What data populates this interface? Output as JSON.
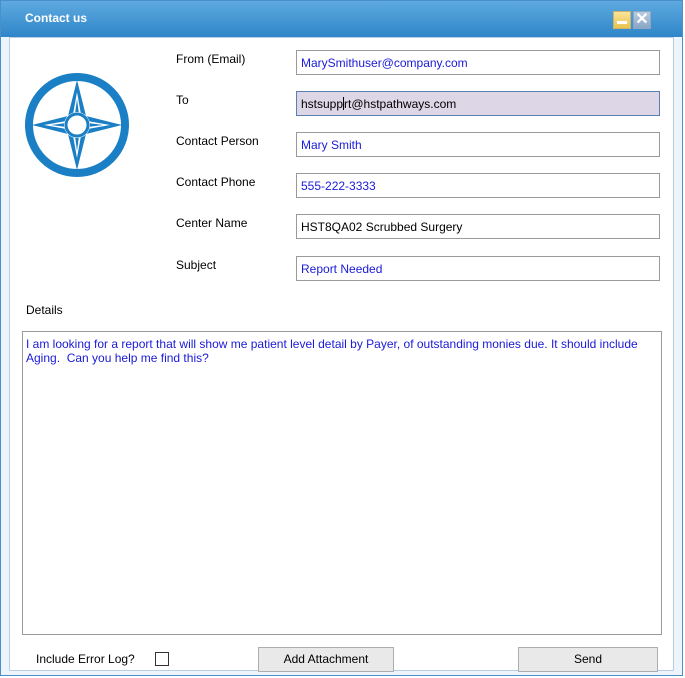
{
  "window": {
    "title": "Contact us",
    "minimize_icon": "minimize-icon",
    "close_icon": "close-icon",
    "close_glyph": "✕"
  },
  "logo": {
    "icon": "compass-logo-icon",
    "color": "#1a7fc4"
  },
  "form": {
    "from_label": "From  (Email)",
    "from_value": "MarySmithuser@company.com",
    "to_label": "To",
    "to_value_before_caret": "hstsupp",
    "to_value_after_caret": "rt@hstpathways.com",
    "contact_person_label": "Contact Person",
    "contact_person_value": "Mary Smith",
    "contact_phone_label": "Contact Phone",
    "contact_phone_value": "555-222-3333",
    "center_name_label": "Center Name",
    "center_name_value": "HST8QA02 Scrubbed Surgery",
    "subject_label": "Subject",
    "subject_value": "Report Needed",
    "details_label": "Details",
    "details_value": "I am looking for a report that will show me patient level detail by Payer, of outstanding monies due. It should include Aging.  Can you help me find this?"
  },
  "footer": {
    "include_error_log_label": "Include Error Log?",
    "include_error_log_checked": false,
    "add_attachment_label": "Add Attachment",
    "send_label": "Send"
  },
  "colors": {
    "titlebar": "#2f86c8",
    "field_text": "#1a1ad8"
  }
}
